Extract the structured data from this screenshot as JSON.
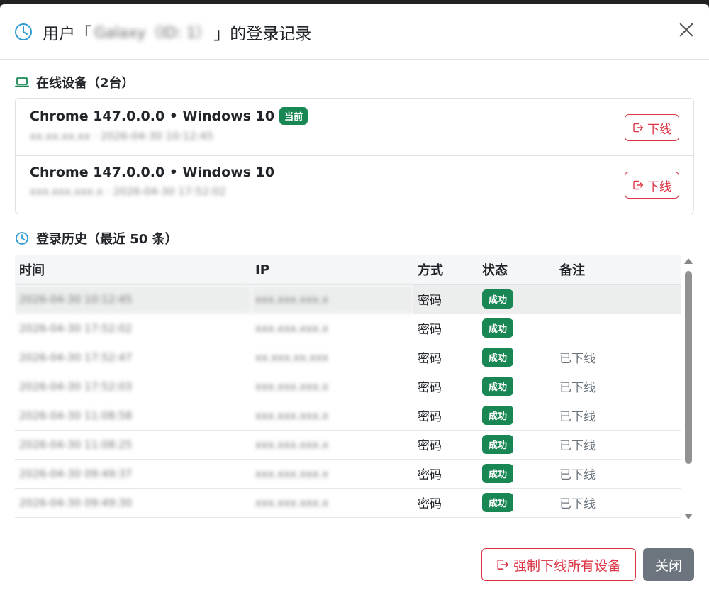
{
  "header": {
    "title_prefix": "用户「",
    "username_blurred": "Galaxy（ID: 1）",
    "title_suffix": "」的登录记录"
  },
  "online": {
    "title": "在线设备（2台）",
    "devices": [
      {
        "name": "Chrome 147.0.0.0 • Windows 10",
        "current_badge": "当前",
        "detail": "xx.xx.xx.xx · 2026-04-30 10:12:45",
        "offline_label": "下线"
      },
      {
        "name": "Chrome 147.0.0.0 • Windows 10",
        "current_badge": "",
        "detail": "xxx.xxx.xxx.x · 2026-04-30 17:52:02",
        "offline_label": "下线"
      }
    ]
  },
  "history": {
    "title": "登录历史（最近 50 条）",
    "columns": [
      "时间",
      "IP",
      "方式",
      "状态",
      "备注"
    ],
    "rows": [
      {
        "time": "2026-04-30 10:12:45",
        "ip": "xxx.xxx.xxx.x",
        "method": "密码",
        "status": "成功",
        "note": ""
      },
      {
        "time": "2026-04-30 17:52:02",
        "ip": "xxx.xxx.xxx.x",
        "method": "密码",
        "status": "成功",
        "note": ""
      },
      {
        "time": "2026-04-30 17:52:47",
        "ip": "xx.xxx.xx.xxx",
        "method": "密码",
        "status": "成功",
        "note": "已下线"
      },
      {
        "time": "2026-04-30 17:52:03",
        "ip": "xxx.xxx.xxx.x",
        "method": "密码",
        "status": "成功",
        "note": "已下线"
      },
      {
        "time": "2026-04-30 11:08:58",
        "ip": "xxx.xxx.xxx.x",
        "method": "密码",
        "status": "成功",
        "note": "已下线"
      },
      {
        "time": "2026-04-30 11:08:25",
        "ip": "xxx.xxx.xxx.x",
        "method": "密码",
        "status": "成功",
        "note": "已下线"
      },
      {
        "time": "2026-04-30 09:49:37",
        "ip": "xxx.xxx.xxx.x",
        "method": "密码",
        "status": "成功",
        "note": "已下线"
      },
      {
        "time": "2026-04-30 09:49:30",
        "ip": "xxx.xxx.xxx.x",
        "method": "密码",
        "status": "成功",
        "note": "已下线"
      }
    ]
  },
  "footer": {
    "force_offline_label": "强制下线所有设备",
    "close_label": "关闭"
  },
  "colors": {
    "success": "#198754",
    "danger": "#dc3545",
    "secondary": "#6c757d",
    "icon": "#2e9ad0"
  },
  "icons": {
    "header": "clock-icon",
    "online": "laptop-icon",
    "history": "clock-icon",
    "offline": "box-arrow-right-icon",
    "close": "close-icon"
  }
}
